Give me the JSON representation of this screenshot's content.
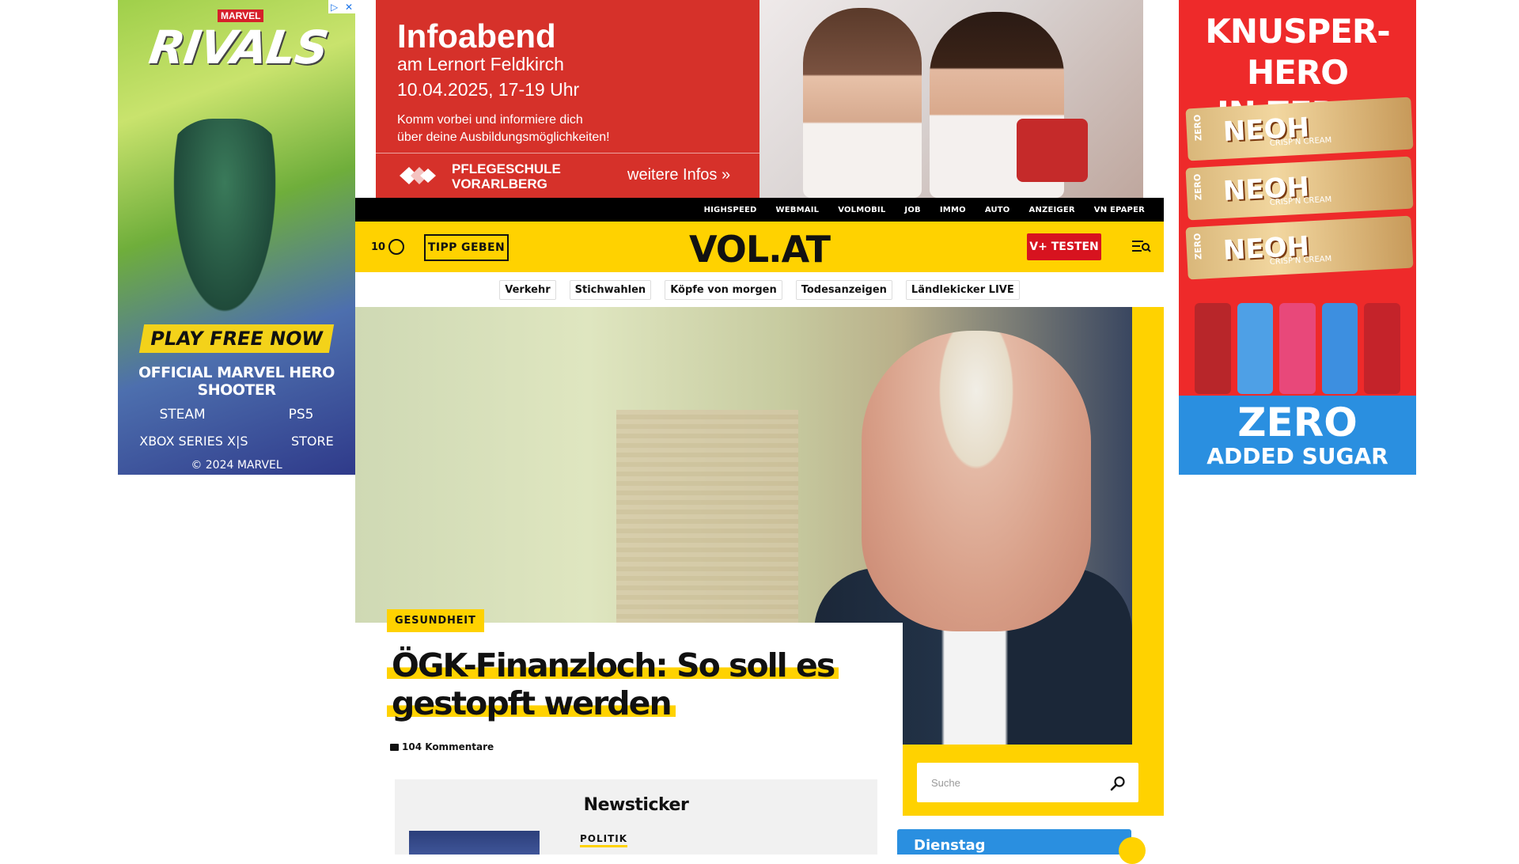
{
  "ads": {
    "left": {
      "brand": "MARVEL",
      "title": "RIVALS",
      "cta": "PLAY FREE NOW",
      "subtitle": "OFFICIAL MARVEL HERO SHOOTER",
      "platforms_row1": [
        "STEAM",
        "PS5"
      ],
      "platforms_row2": [
        "XBOX SERIES X|S",
        "STORE"
      ],
      "copyright": "© 2024 MARVEL",
      "choices_icons": [
        "adchoices-icon",
        "close-icon"
      ]
    },
    "top": {
      "title": "Infoabend",
      "line1": "am Lernort Feldkirch",
      "line2": "10.04.2025, 17-19 Uhr",
      "body1": "Komm vorbei und informiere dich",
      "body2": "über deine Ausbildungsmöglichkeiten!",
      "school_line1": "PFLEGESCHULE",
      "school_line2": "VORARLBERG",
      "more": "weitere Infos »"
    },
    "right": {
      "headline1": "KNUSPER-HERO",
      "headline2": "IN ZERO!",
      "bars": [
        {
          "label": "NEOH",
          "sub": "CRISP'N CREAM",
          "side": "ZERO"
        },
        {
          "label": "NEOH",
          "sub": "CRISP'N CREAM",
          "side": "ZERO"
        },
        {
          "label": "NEOH",
          "sub": "CRISP'N CREAM",
          "side": "ZERO"
        }
      ],
      "zero": "ZERO",
      "added_sugar": "ADDED SUGAR"
    }
  },
  "topnav": {
    "items": [
      "HIGHSPEED",
      "WEBMAIL",
      "VOLMOBIL",
      "JOB",
      "IMMO",
      "AUTO",
      "ANZEIGER",
      "VN EPAPER"
    ]
  },
  "header": {
    "count": "10",
    "tipp": "TIPP GEBEN",
    "logo": "VOL.AT",
    "vplus": "V+ TESTEN",
    "colors": {
      "accent": "#ffd200",
      "vplus": "#d7131f"
    }
  },
  "tags": [
    "Verkehr",
    "Stichwahlen",
    "Köpfe von morgen",
    "Todesanzeigen",
    "Ländlekicker LIVE"
  ],
  "article": {
    "category": "GESUNDHEIT",
    "headline_line1": "ÖGK-Finanzloch: So soll es",
    "headline_line2": "gestopft werden",
    "comments": "104 Kommentare"
  },
  "search": {
    "placeholder": "Suche"
  },
  "newsticker": {
    "title": "Newsticker",
    "first_category": "POLITIK"
  },
  "weather": {
    "day": "Dienstag"
  }
}
